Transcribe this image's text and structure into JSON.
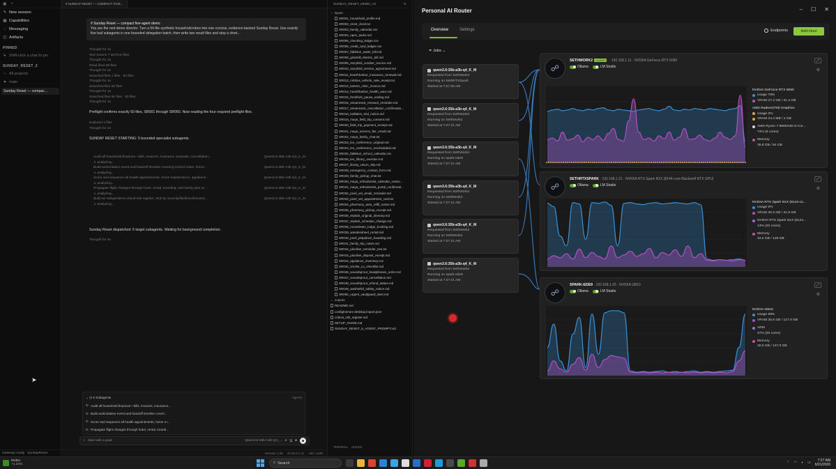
{
  "sidebar": {
    "nav": [
      {
        "icon": "pencil-icon",
        "label": "New session"
      },
      {
        "icon": "grid-icon",
        "label": "Capabilities"
      },
      {
        "icon": "chat-icon",
        "label": "Messaging"
      },
      {
        "icon": "box-icon",
        "label": "Artifacts"
      }
    ],
    "pinned_title": "PINNED",
    "pinned_hint": "Shift-click a chat to pin",
    "workspace_title": "SUNDAY_RESET_2",
    "all_projects": "All projects",
    "group": "main",
    "active_thread": "Sunday Reset — compac...",
    "status": [
      "Gateway ready",
      "SundayReset"
    ]
  },
  "chat": {
    "tab": "# SUNDAY RESET — COMPACT FIVE...",
    "prompt_title": "# Sunday Reset — compact five-agent demo",
    "prompt_body": "You are the root demo director. Turn a 50-file synthetic household inbox into one concise, evidence-backed Sunday Reset. Use exactly five leaf subagents in one bounded delegation batch, then write two result files and stop a short...",
    "log": [
      {
        "t": "Thought for 1s",
        "c": "muted"
      },
      {
        "t": "Text Search   7 MATCH files",
        "c": "muted"
      },
      {
        "t": "Thought for 1s",
        "c": "muted"
      },
      {
        "t": "Read lines   80 files",
        "c": "muted"
      },
      {
        "t": "Thought for 2s",
        "c": "muted"
      },
      {
        "t": "Searched files   1 files · 50 files",
        "c": "muted"
      },
      {
        "t": "Thought for 1s",
        "c": "muted"
      },
      {
        "t": "Searched files   50 files",
        "c": "muted"
      },
      {
        "t": "Thought for 1s",
        "c": "muted"
      },
      {
        "t": "Searched files   60 files · 80 files",
        "c": "muted"
      },
      {
        "t": "Thought for 1s",
        "c": "muted"
      },
      {
        "t": "",
        "c": "muted"
      },
      {
        "t": "Preflight confirms exactly 50 files, SR001 through SR050. Now reading the four required preflight files.",
        "c": "bright"
      },
      {
        "t": "",
        "c": "muted"
      },
      {
        "t": "Explored 4 files",
        "c": "muted"
      },
      {
        "t": "Thought for 1s",
        "c": "muted"
      },
      {
        "t": "",
        "c": "muted"
      },
      {
        "t": "SUNDAY RESET STARTING: 5 bounded specialist subagents.",
        "c": "bright"
      }
    ],
    "subagent_lines": [
      {
        "t": "Audit all household finances—bills, invoices, insurance renewals, cancellation...",
        "m": "Qwen3.6-35b-A3b-Q4_K_M"
      },
      {
        "t": "↳ analyzing...",
        "m": ""
      },
      {
        "t": "Build authoritative event-and-handoff timeline covering school notes, forms...",
        "m": "Qwen3.6-35b-A3b-Q4_K_M"
      },
      {
        "t": "↳ analyzing...",
        "m": ""
      },
      {
        "t": "Score and sequence all health appointments, home maintenance, appliance...",
        "m": "Qwen3.6-35b-A3b-Q4_K_M"
      },
      {
        "t": "↳ analyzing...",
        "m": ""
      },
      {
        "t": "Propagate flight changes through hotel, rental, boarding, and family plan re...",
        "m": "Qwen3.6-35b-A3b-Q4_K_M"
      },
      {
        "t": "↳ analyzing...",
        "m": ""
      },
      {
        "t": "Build an independent critical-risk register, rank by severity/likelihood/reversi...",
        "m": "Qwen3.6-35b-A3b-Q4_K_M"
      },
      {
        "t": "↳ analyzing...",
        "m": ""
      }
    ],
    "dispatch_msg": "Sunday Reset dispatched: 5 target subagents. Waiting for background completion.",
    "last_thought": "Thought for 4s",
    "panel_title": "5 Subagents",
    "panel_right": "Agents",
    "panel_rows": [
      "Audit all household finances—bills, invoices, insurance...",
      "Build authoritative event-and-handoff timeline coveri...",
      "Score and sequence all health appointments, home m...",
      "Propagate flight changes through hotel, rental, boardi...",
      "Build an independent critical-risk register, rank by sev..."
    ],
    "composer_placeholder": "Start with a goal",
    "composer_model": "Qwen3.6-35b-A3b-Q4_...",
    "footer": [
      "Session 1:36",
      "v0.10.0 (+1)",
      "+50 / 1180"
    ]
  },
  "files": {
    "title": "SUNDAY_RESET_DEMO_V2",
    "inputs_folder": "inputs",
    "items": [
      "SR001_household_profile.md",
      "SR002_reset_clock.txt",
      "SR003_family_calendar.csv",
      "SR004_open_tasks.md",
      "SR005_checking_ledger.csv",
      "SR006_credit_card_ledger.csv",
      "SR007_fabletun_water_bill.md",
      "SR008_gristmill_electric_bill.md",
      "SR009_storybird_october_invoice.md",
      "SR010_storybird_service_agreement.md",
      "SR011_hearthharbor_insurance_renewal.md",
      "SR012_nimbus_vehicle_sale_receipt.txt",
      "SR013_lantern_clinic_invoice.md",
      "SR014_hearthharbor_health_auto.md",
      "SR015_freshfork_pause_ending.md",
      "SR016_streamnest_renewal_reminder.md",
      "SR017_streamnest_cancellation_confirmatio...",
      "SR018_trailtales_trial_notice.md",
      "SR019_maya_field_trip_consent.md",
      "SR020_field_trip_payment_receipt.md",
      "SR021_maya_science_fair_email.md",
      "SR022_maya_family_chat.txt",
      "SR023_leo_conference_original.md",
      "SR024_leo_conference_rescheduled.md",
      "SR025_fabletun_school_calendar.csv",
      "SR026_leo_library_overdue.md",
      "SR027_library_return_slip.md",
      "SR028_emergency_contact_form.md",
      "SR029_family_pickup_chat.txt",
      "SR030_maya_orthodontist_calendar_notice...",
      "SR031_maya_orthodontist_portal_confirmati...",
      "SR032_pixel_vet_email_reminder.md",
      "SR033_pixel_vet_appointment_card.txt",
      "SR034_pharmacy_auto_refill_notice.md",
      "SR035_pharmacy_pickup_receipt.md",
      "SR036_skylark_original_itinerary.md",
      "SR037_skylark_schedule_change.md",
      "SR038_moonbeam_lodge_booking.md",
      "SR039_wanderwheel_rental.md",
      "SR040_pixel_petpalace_boarding.md",
      "SR041_family_trip_notes.md",
      "SR042_plumber_reminder_text.txt",
      "SR043_plumber_deposit_receipt.md",
      "SR044_appliance_inventory.csv",
      "SR045_smoke_co_checklist.md",
      "SR046_soundsprout_headphones_order.md",
      "SR047_soundsprout_cancellation.md",
      "SR048_soundsprout_refund_status.md",
      "SR049_washwhirl_safety_notice.md",
      "SR050_urgent_vaultguard_alert.md"
    ],
    "outputs_folder": "outputs",
    "root_files": [
      "README.md",
      "config/nemex-desktop.import.json",
      "critical_risk_register.md",
      "SETUP_GUIDE.md",
      "SUNDAY_RESET_5_AGENT_PROMPT.md"
    ],
    "footer": [
      "TERMINAL",
      "ISSUES"
    ]
  },
  "router": {
    "title": "Personal AI Router",
    "tabs": [
      "Overview",
      "Settings"
    ],
    "endpoints_label": "Endpoints",
    "add_label": "Add Host",
    "jobs_label": "Jobs",
    "jobs": [
      {
        "model": "qwen3.6:35b-a3b-q4_K_M",
        "req": "Requested from SethWork2",
        "run": "Running on SethRTXSpark",
        "start": "Started at 7:27:26 AM"
      },
      {
        "model": "qwen3.6:35b-a3b-q4_K_M",
        "req": "Requested from SethWork2",
        "run": "Running on SethWork2",
        "start": "Started at 7:27:21 AM"
      },
      {
        "model": "qwen3.6:35b-a3b-q4_K_M",
        "req": "Requested from SethWork2",
        "run": "Running on spark-ede9",
        "start": "Started at 7:27:21 AM"
      },
      {
        "model": "qwen3.6:35b-a3b-q4_K_M",
        "req": "Requested from SethWork2",
        "run": "Running on SethWork2",
        "start": "Started at 7:27:21 AM"
      },
      {
        "model": "qwen3.6:35b-a3b-q4_K_M",
        "req": "Requested from SethWork2",
        "run": "Running on SethWork2",
        "start": "Started at 7:27:21 AM"
      },
      {
        "model": "qwen3.6:35b-a3b-q4_K_M",
        "req": "Requested from SethWork2",
        "run": "Running on spark-ede9",
        "start": "Started at 7:27:21 AM"
      }
    ],
    "hosts": [
      {
        "name": "SETHWORK2",
        "badge": "CLIENT",
        "ip": "192.168.1.11",
        "gpu": "NVIDIA GeForce RTX 5090",
        "toggles": [
          "Ollama",
          "LM Studio"
        ],
        "stats": [
          {
            "type": "dev",
            "t": "NVIDIA GeForce RTX 5090"
          },
          {
            "type": "s",
            "color": "#3b8fd6",
            "t": "Usage  78%"
          },
          {
            "type": "s",
            "color": "#b34fc2",
            "t": "VRAM  27.4 GB / 31.4 GB"
          },
          {
            "type": "gap",
            "t": ""
          },
          {
            "type": "dev",
            "t": "AMD Radeon(TM) Graphics"
          },
          {
            "type": "s",
            "color": "#e0a23a",
            "t": "Usage  0%"
          },
          {
            "type": "s",
            "color": "#e0a23a",
            "t": "VRAM  24.4 MB / 2 GB"
          },
          {
            "type": "gap",
            "t": ""
          },
          {
            "type": "s",
            "color": "#d8d8d8",
            "t": "AMD Ryzen 7 9800X3D 8-Cor..."
          },
          {
            "type": "s",
            "color": "",
            "t": "74% (8 cores)"
          },
          {
            "type": "gap",
            "t": ""
          },
          {
            "type": "s",
            "color": "#c44fa6",
            "t": "Memory"
          },
          {
            "type": "s",
            "color": "",
            "t": "35.8 GB / 64 GB"
          }
        ]
      },
      {
        "name": "SETHRTXSPARK",
        "badge": "",
        "ip": "192.168.1.21",
        "gpu": "NVIDIA RTX Spark N1X (8144-core Blackwell RTX GPU)",
        "toggles": [
          "Ollama",
          "LM Studio"
        ],
        "stats": [
          {
            "type": "dev",
            "t": "NVIDIA RTX Spark N1X (8144-co..."
          },
          {
            "type": "s",
            "color": "#3b8fd6",
            "t": "Usage  0%"
          },
          {
            "type": "s",
            "color": "#b34fc2",
            "t": "VRAM  30.3 GB / 31.9 GB"
          },
          {
            "type": "gap",
            "t": ""
          },
          {
            "type": "s",
            "color": "#9b6fd6",
            "t": "NVIDIA RTX Spark N1X (8144..."
          },
          {
            "type": "s",
            "color": "",
            "t": "13% (20 cores)"
          },
          {
            "type": "gap",
            "t": ""
          },
          {
            "type": "s",
            "color": "#c44fa6",
            "t": "Memory"
          },
          {
            "type": "s",
            "color": "",
            "t": "33.2 GB / 128 GB"
          }
        ]
      },
      {
        "name": "SPARK-EDE9",
        "badge": "",
        "ip": "192.168.1.25",
        "gpu": "NVIDIA GB10",
        "toggles": [
          "Ollama",
          "LM Studio"
        ],
        "stats": [
          {
            "type": "dev",
            "t": "NVIDIA GB10"
          },
          {
            "type": "s",
            "color": "#3b8fd6",
            "t": "Usage  98%"
          },
          {
            "type": "s",
            "color": "#b34fc2",
            "t": "VRAM  35.5 GB / 127.9 GB"
          },
          {
            "type": "gap",
            "t": ""
          },
          {
            "type": "s",
            "color": "#9b6fd6",
            "t": "ARM"
          },
          {
            "type": "s",
            "color": "",
            "t": "47% (20 cores)"
          },
          {
            "type": "gap",
            "t": ""
          },
          {
            "type": "s",
            "color": "#c44fa6",
            "t": "Memory"
          },
          {
            "type": "s",
            "color": "",
            "t": "35.5 GB / 127.9 GB"
          }
        ]
      }
    ]
  },
  "chart_data": [
    {
      "type": "area",
      "series": [
        {
          "name": "Usage",
          "color": "#3b8fd6",
          "values": [
            68,
            70,
            71,
            69,
            70,
            72,
            70,
            69,
            71,
            70,
            72,
            73,
            70,
            69,
            71,
            70,
            69,
            68,
            70,
            71,
            72,
            70,
            69,
            71,
            75,
            70,
            69,
            71,
            70,
            72,
            71,
            70,
            72,
            71,
            70,
            69,
            71,
            72,
            76,
            28
          ]
        },
        {
          "name": "VRAM",
          "color": "#b34fc2",
          "values": [
            30,
            32,
            28,
            40,
            29,
            31,
            36,
            27,
            33,
            30,
            35,
            29,
            38,
            45,
            30,
            28,
            55,
            85,
            40,
            30,
            32,
            28,
            35,
            31,
            40,
            29,
            33,
            45,
            30,
            31,
            36,
            30,
            28,
            32,
            40,
            33,
            30,
            35,
            90,
            20
          ]
        }
      ],
      "ylim": [
        0,
        100
      ]
    },
    {
      "type": "area",
      "series": [
        {
          "name": "Usage",
          "color": "#3b8fd6",
          "values": [
            95,
            90,
            45,
            30,
            96,
            94,
            40,
            96,
            95,
            97,
            92,
            30,
            95,
            96,
            94,
            93,
            95,
            96,
            94,
            95,
            96,
            95,
            94,
            96,
            93,
            10,
            8,
            9,
            8,
            9,
            10,
            8
          ]
        },
        {
          "name": "VRAM",
          "color": "#b34fc2",
          "values": [
            10,
            15,
            12,
            18,
            10,
            25,
            12,
            20,
            14,
            10,
            30,
            12,
            16,
            22,
            14,
            18,
            26,
            12,
            20,
            16,
            24,
            14,
            30,
            12,
            18,
            8,
            7,
            9,
            8,
            7,
            9,
            8
          ]
        }
      ],
      "ylim": [
        0,
        100
      ]
    },
    {
      "type": "area",
      "series": [
        {
          "name": "Usage",
          "color": "#3b8fd6",
          "values": [
            40,
            75,
            20,
            5,
            60,
            85,
            10,
            90,
            30,
            92,
            95,
            95,
            92,
            5,
            3,
            4,
            3,
            4,
            5,
            3,
            4,
            3,
            4,
            5,
            3,
            4,
            3,
            4,
            5,
            6,
            40,
            90
          ]
        },
        {
          "name": "VRAM",
          "color": "#b34fc2",
          "values": [
            5,
            20,
            8,
            3,
            15,
            25,
            6,
            30,
            10,
            22,
            28,
            26,
            24,
            3,
            2,
            3,
            2,
            3,
            2,
            3,
            2,
            3,
            2,
            3,
            2,
            3,
            2,
            3,
            2,
            4,
            20,
            35
          ]
        }
      ],
      "ylim": [
        0,
        100
      ]
    }
  ],
  "taskbar": {
    "left_title": "NVDA",
    "left_sub": "+1.23%",
    "search": "Search",
    "time": "7:27 AM",
    "date": "6/01/2026"
  },
  "colors": {
    "accent": "#8dc63f",
    "usage": "#3b8fd6",
    "vram": "#b34fc2"
  }
}
